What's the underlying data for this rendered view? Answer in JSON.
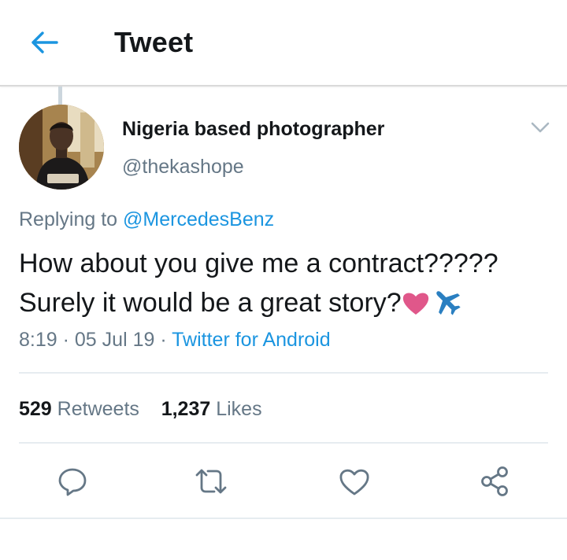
{
  "header": {
    "title": "Tweet",
    "back_icon": "arrow-left-icon"
  },
  "tweet": {
    "author": {
      "name": "Nigeria based photographer",
      "handle": "@thekashope"
    },
    "replying_prefix": "Replying to",
    "replying_to": "@MercedesBenz",
    "text_line_1": "How about you give me a contract?????",
    "text_line_2": "Surely it would be a great story?",
    "emojis": [
      "heart-emoji",
      "airplane-emoji"
    ],
    "time": "8:19",
    "sep1": "·",
    "date": "05 Jul 19",
    "sep2": "·",
    "source": "Twitter for Android"
  },
  "stats": {
    "retweets_count": "529",
    "retweets_label": "Retweets",
    "likes_count": "1,237",
    "likes_label": "Likes"
  },
  "actions": [
    "reply-icon",
    "retweet-icon",
    "like-icon",
    "share-icon"
  ],
  "colors": {
    "accent": "#1b95e0",
    "secondary_text": "#657786",
    "primary_text": "#14171a",
    "heart": "#e0578a",
    "airplane": "#2a7fc1"
  }
}
